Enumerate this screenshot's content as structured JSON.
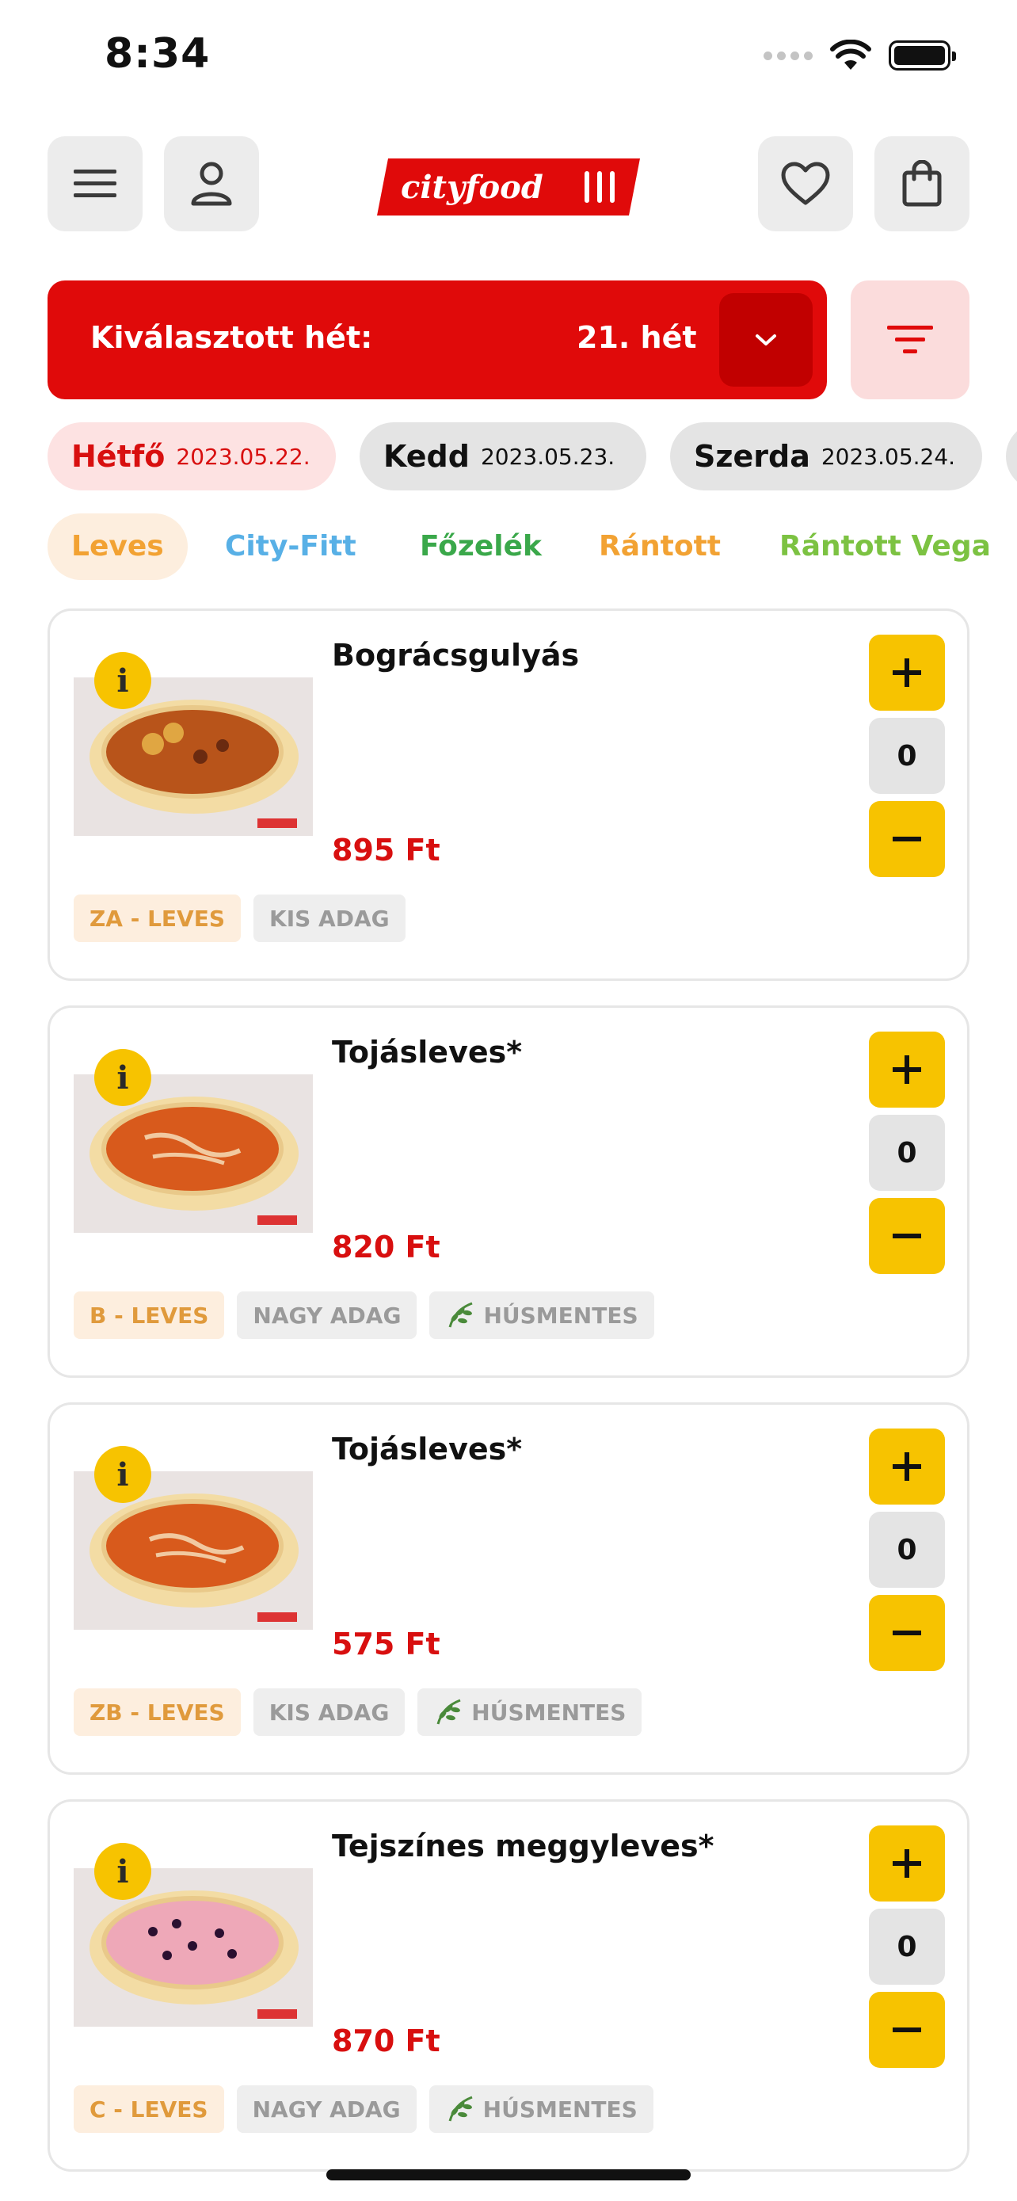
{
  "status": {
    "time": "8:34"
  },
  "header": {
    "logo_text": "cityfood",
    "icons": [
      "menu-icon",
      "user-icon",
      "heart-icon",
      "shopping-bag-icon"
    ]
  },
  "week": {
    "label": "Kiválasztott hét:",
    "value": "21. hét"
  },
  "days": [
    {
      "name": "Hétfő",
      "date": "2023.05.22.",
      "active": true
    },
    {
      "name": "Kedd",
      "date": "2023.05.23.",
      "active": false
    },
    {
      "name": "Szerda",
      "date": "2023.05.24.",
      "active": false
    }
  ],
  "categories": [
    {
      "label": "Leves",
      "color": "#f2a233",
      "active": true
    },
    {
      "label": "City-Fitt",
      "color": "#58b0e6",
      "active": false
    },
    {
      "label": "Főzelék",
      "color": "#3aa84a",
      "active": false
    },
    {
      "label": "Rántott",
      "color": "#f2a233",
      "active": false
    },
    {
      "label": "Rántott Vega",
      "color": "#7cc242",
      "active": false
    }
  ],
  "items": [
    {
      "name": "Bográcsgulyás",
      "price": "895 Ft",
      "quantity": "0",
      "tags": [
        "ZA - LEVES",
        "KIS ADAG"
      ],
      "meatless": false
    },
    {
      "name": "Tojásleves*",
      "price": "820 Ft",
      "quantity": "0",
      "tags": [
        "B - LEVES",
        "NAGY ADAG"
      ],
      "meatless": true,
      "meatless_label": "HÚSMENTES"
    },
    {
      "name": "Tojásleves*",
      "price": "575 Ft",
      "quantity": "0",
      "tags": [
        "ZB - LEVES",
        "KIS ADAG"
      ],
      "meatless": true,
      "meatless_label": "HÚSMENTES"
    },
    {
      "name": "Tejszínes meggyleves*",
      "price": "870 Ft",
      "quantity": "0",
      "tags": [
        "C - LEVES",
        "NAGY ADAG"
      ],
      "meatless": true,
      "meatless_label": "HÚSMENTES"
    }
  ],
  "colors": {
    "brand_red": "#e00a0a",
    "accent_yellow": "#f7c300",
    "price_red": "#d80f0f"
  }
}
